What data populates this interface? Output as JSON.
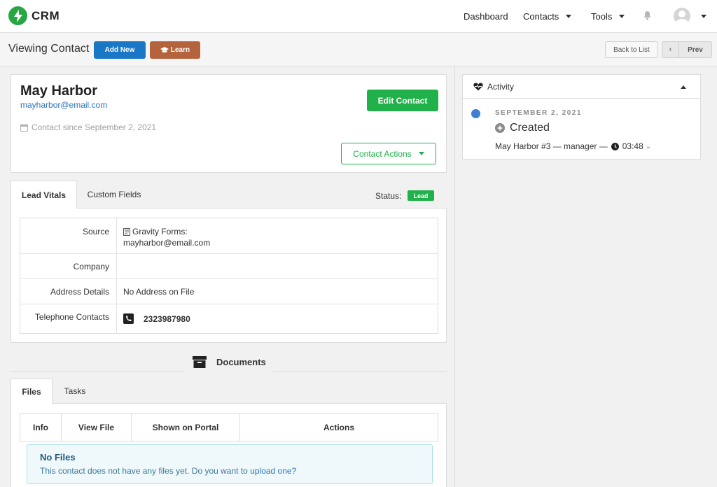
{
  "brand": {
    "name": "CRM",
    "color": "#26a744"
  },
  "nav": {
    "dashboard": "Dashboard",
    "contacts": "Contacts",
    "tools": "Tools"
  },
  "subheader": {
    "title": "Viewing Contact",
    "add_new": "Add New",
    "learn": "Learn",
    "back_to_list": "Back to List",
    "prev": "Prev"
  },
  "contact": {
    "name": "May Harbor",
    "email": "mayharbor@email.com",
    "since": "Contact since September 2, 2021",
    "edit_label": "Edit Contact",
    "actions_label": "Contact Actions"
  },
  "tabs": {
    "lead_vitals": "Lead Vitals",
    "custom_fields": "Custom Fields",
    "status_label": "Status:",
    "status_value": "Lead"
  },
  "vitals": {
    "source_label": "Source",
    "source_value_line1": "Gravity Forms:",
    "source_value_line2": "mayharbor@email.com",
    "company_label": "Company",
    "company_value": "",
    "address_label": "Address Details",
    "address_value": "No Address on File",
    "phone_label": "Telephone Contacts",
    "phone_value": "2323987980"
  },
  "documents": {
    "heading": "Documents",
    "tab_files": "Files",
    "tab_tasks": "Tasks",
    "columns": [
      "Info",
      "View File",
      "Shown on Portal",
      "Actions"
    ],
    "empty_title": "No Files",
    "empty_text": "This contact does not have any files yet. Do you want to",
    "empty_link": "upload one?"
  },
  "activity": {
    "title": "Activity",
    "date": "SEPTEMBER 2, 2021",
    "event": "Created",
    "meta": "May Harbor #3 — manager —",
    "time": "03:48"
  },
  "colors": {
    "primary": "#1a77c6",
    "learn": "#b4633d",
    "success": "#21b14a",
    "link": "#2a73c2",
    "timeline_dot": "#3e7fcf"
  }
}
